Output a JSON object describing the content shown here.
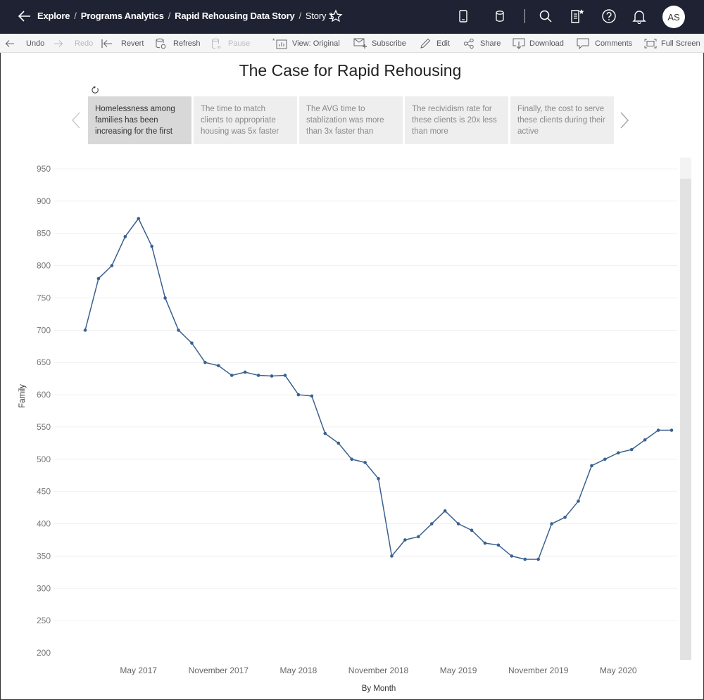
{
  "topbar": {
    "breadcrumbs": [
      "Explore",
      "Programs Analytics",
      "Rapid Rehousing Data Story",
      "Story 1"
    ],
    "separator": "/",
    "avatar_initials": "AS",
    "icons": [
      "back-arrow-icon",
      "star-icon",
      "mobile-device-icon",
      "database-icon",
      "search-icon",
      "data-guide-icon",
      "help-icon",
      "bell-icon"
    ]
  },
  "toolbar": {
    "undo": "Undo",
    "redo": "Redo",
    "revert": "Revert",
    "refresh": "Refresh",
    "pause": "Pause",
    "view": "View: Original",
    "subscribe": "Subscribe",
    "edit": "Edit",
    "share": "Share",
    "download": "Download",
    "comments": "Comments",
    "fullscreen": "Full Screen"
  },
  "story": {
    "title": "The Case for Rapid Rehousing",
    "points": [
      {
        "text": "Homelessness among families has been increasing for the first",
        "active": true
      },
      {
        "text": "The time to match clients to appropriate housing was 5x faster",
        "active": false
      },
      {
        "text": "The AVG time to stablization was more than 3x faster  than",
        "active": false
      },
      {
        "text": "The recividism rate for these clients is 20x less than more",
        "active": false
      },
      {
        "text": "Finally, the cost to serve these clients during their active",
        "active": false
      }
    ]
  },
  "colors": {
    "line": "#3a6190",
    "topbar_bg": "#1f2233"
  },
  "chart_data": {
    "type": "line",
    "title": "",
    "xlabel": "By Month",
    "ylabel": "Family",
    "ylim": [
      200,
      950
    ],
    "yticks": [
      200,
      250,
      300,
      350,
      400,
      450,
      500,
      550,
      600,
      650,
      700,
      750,
      800,
      850,
      900,
      950
    ],
    "grid": true,
    "x_start": "January 2017",
    "x_tick_labels": [
      {
        "label": "May 2017",
        "index": 4
      },
      {
        "label": "November 2017",
        "index": 10
      },
      {
        "label": "May 2018",
        "index": 16
      },
      {
        "label": "November 2018",
        "index": 22
      },
      {
        "label": "May 2019",
        "index": 28
      },
      {
        "label": "November 2019",
        "index": 34
      },
      {
        "label": "May 2020",
        "index": 40
      }
    ],
    "series": [
      {
        "name": "Family",
        "values": [
          700,
          780,
          800,
          845,
          873,
          830,
          750,
          700,
          680,
          650,
          645,
          630,
          635,
          630,
          629,
          630,
          600,
          598,
          540,
          525,
          500,
          495,
          470,
          350,
          375,
          380,
          400,
          420,
          400,
          390,
          370,
          367,
          350,
          345,
          345,
          400,
          410,
          435,
          490,
          500,
          510,
          515,
          530,
          545,
          545
        ]
      }
    ]
  }
}
